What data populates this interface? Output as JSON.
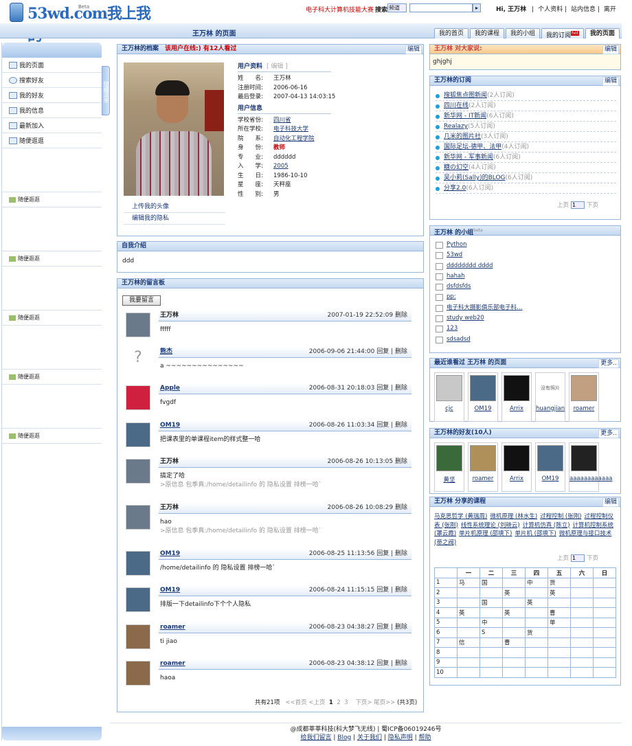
{
  "topbar": {
    "logo": "53wd.com我上我的",
    "logo_beta": "Beta",
    "contest_link": "电子科大计算机技能大赛",
    "search_label": "搜索",
    "search_scope": "频道",
    "search_value": "",
    "greeting": "Hi, 王万林",
    "links": [
      "个人资料",
      "站内信息",
      "离开"
    ]
  },
  "header": {
    "page_title": "王万林 的页面",
    "tabs": [
      "我的首页",
      "我的课程",
      "我的小组",
      "我的订阅",
      "我的页面"
    ],
    "tab_hot": "hot",
    "active_tab": "我的页面"
  },
  "sidebar": {
    "hide_menu": "隐藏菜单",
    "items": [
      "我的页面",
      "搜索好友",
      "我的好友",
      "我的信息",
      "最新加入",
      "随便逛逛"
    ],
    "repeat_items": [
      "随便逛逛",
      "随便逛逛",
      "随便逛逛",
      "随便逛逛",
      "随便逛逛"
    ]
  },
  "profile": {
    "title": "王万林的档案",
    "status": "该用户在线:) 有12人看过",
    "edit": "编辑",
    "photo_links": [
      "上传我的头像",
      "编辑我的隐私"
    ],
    "user_info_title": "用户资料",
    "user_info_edit": "[ 编辑 ]",
    "user_info": [
      {
        "k": "姓　　名:",
        "v": "王万林"
      },
      {
        "k": "注册时间:",
        "v": "2006-06-16"
      },
      {
        "k": "最后登录:",
        "v": "2007-04-13 14:03:15"
      }
    ],
    "user_detail_title": "用户信息",
    "user_detail_edit": "[ 编辑 ]",
    "user_detail": [
      {
        "k": "学校省份:",
        "v": "四川省"
      },
      {
        "k": "所在学校:",
        "v": "电子科技大学"
      },
      {
        "k": "院　　系:",
        "v": "自动化工程学院"
      },
      {
        "k": "身　　份:",
        "v": "教师"
      },
      {
        "k": "专　　业:",
        "v": "dddddd"
      },
      {
        "k": "入　　学:",
        "v": "2005"
      },
      {
        "k": "生　　日:",
        "v": "1986-10-10"
      },
      {
        "k": "星　　座:",
        "v": "天秤座"
      },
      {
        "k": "性　　别:",
        "v": "男"
      }
    ]
  },
  "intro": {
    "title": "自我介绍",
    "text": "ddd"
  },
  "board": {
    "title": "王万林的留言板",
    "leave_button": "我要留言",
    "messages": [
      {
        "name": "王万林",
        "time": "2007-01-19 22:52:09",
        "actions": "删除",
        "body": "fffff",
        "quote": ""
      },
      {
        "name": "熊杰",
        "time": "2006-09-06 21:44:00",
        "actions": "回复 | 删除",
        "body": "a ~~~~~~~~~~~~~~~",
        "quote": ""
      },
      {
        "name": "Apple",
        "time": "2006-08-31 20:18:03",
        "actions": "回复 | 删除",
        "body": "fvgdf",
        "quote": ""
      },
      {
        "name": "OM19",
        "time": "2006-08-26 11:03:34",
        "actions": "回复 | 删除",
        "body": "把课表里的单课程item的样式整一哈",
        "quote": ""
      },
      {
        "name": "王万林",
        "time": "2006-08-26 10:13:05",
        "actions": "删除",
        "body": "搞定了哈",
        "quote": ">原信息 包季真:/home/detailinfo 的 隐私设置 排榜一哈`"
      },
      {
        "name": "王万林",
        "time": "2006-08-26 10:08:29",
        "actions": "删除",
        "body": "hao",
        "quote": ">原信息 包季真:/home/detailinfo 的 隐私设置 排榜一哈`"
      },
      {
        "name": "OM19",
        "time": "2006-08-25 11:13:56",
        "actions": "回复 | 删除",
        "body": "/home/detailinfo 的 隐私设置 排榜一哈`",
        "quote": ""
      },
      {
        "name": "OM19",
        "time": "2006-08-24 11:15:15",
        "actions": "回复 | 删除",
        "body": "排版一下detailinfo下个个人隐私",
        "quote": ""
      },
      {
        "name": "roamer",
        "time": "2006-08-23 04:38:27",
        "actions": "回复 | 删除",
        "body": "ti jiao",
        "quote": ""
      },
      {
        "name": "roamer",
        "time": "2006-08-23 04:38:12",
        "actions": "回复 | 删除",
        "body": "haoa",
        "quote": ""
      }
    ],
    "pager": {
      "total": "共有21项",
      "first": "<<首页",
      "prev": "<上页",
      "pages": [
        "1",
        "2",
        "3"
      ],
      "next": "下页>",
      "last": "尾页>>",
      "count": "(共3页)"
    }
  },
  "shout": {
    "title": "王万林 对大家说:",
    "edit": "编辑",
    "text": "ghjghj"
  },
  "subscriptions": {
    "title": "王万林的订阅",
    "edit": "编辑",
    "items": [
      {
        "name": "搜狐焦点图新闻",
        "count": "(2人订阅)"
      },
      {
        "name": "四川在线",
        "count": "(2人订阅)"
      },
      {
        "name": "新华网 - IT新闻",
        "count": "(6人订阅)"
      },
      {
        "name": "Realazy",
        "count": "(5人订阅)"
      },
      {
        "name": "几米的图片社",
        "count": "(3人订阅)"
      },
      {
        "name": "国际足坛-德甲、法甲",
        "count": "(4人订阅)"
      },
      {
        "name": "新华网 - 军事新闻",
        "count": "(6人订阅)"
      },
      {
        "name": "糖の幻空",
        "count": "(4人订阅)"
      },
      {
        "name": "吴小莉(Sally)的BLOG",
        "count": "(6人订阅)"
      },
      {
        "name": "分享2.0",
        "count": "(6人订阅)"
      }
    ],
    "pager": {
      "prev": "上页",
      "page": "1",
      "next": "下页"
    }
  },
  "groups": {
    "title": "王万林 的小组",
    "beta": "beta",
    "items": [
      "Python",
      "53wd",
      "dddddddd dddd",
      "hahah",
      "dsfdsfds",
      "pp:",
      "电子科大摄影俱乐部电子科…",
      "study web20",
      "123",
      "sdsadsd"
    ]
  },
  "visitors": {
    "title": "最近谁看过 王万林 的页面",
    "more": "更多..",
    "items": [
      "cjc",
      "OM19",
      "Arrix",
      "huangjian",
      "roamer"
    ],
    "no_photo": "没有照片"
  },
  "friends": {
    "title": "王万林的好友(10人)",
    "more": "更多..",
    "items": [
      "黄坚",
      "roamer",
      "Arrix",
      "OM19",
      "aaaaaaaaaaaa"
    ]
  },
  "courses": {
    "title": "王万林 分享的课程",
    "edit": "编辑",
    "items": [
      "马克思哲学 (黄瑞周)",
      "微机原理 (林水生)",
      "过程控制 (张刚)",
      "过程控制仪表 (张刚)",
      "线性系统理论 (刘晓云)",
      "计算机仿真 (陈立)",
      "计算机控制系统 (罩云霞)",
      "单片机原理 (邵塽下)",
      "单片机 (邵塽下)",
      "微机原理与接口技术 (蒂之阀)"
    ],
    "pager": {
      "prev": "上页",
      "page": "1",
      "next": "下页"
    },
    "table_headers": [
      "",
      "一",
      "二",
      "三",
      "四",
      "五",
      "六",
      "日"
    ],
    "table_rows": [
      [
        "1",
        "马",
        "国",
        "",
        "中",
        "货",
        "",
        ""
      ],
      [
        "2",
        "",
        "",
        "英",
        "",
        "英",
        "",
        ""
      ],
      [
        "3",
        "",
        "国",
        "",
        "英",
        "",
        "",
        ""
      ],
      [
        "4",
        "英",
        "",
        "英",
        "",
        "曹",
        "",
        ""
      ],
      [
        "5",
        "",
        "中",
        "",
        "",
        "单",
        "",
        ""
      ],
      [
        "6",
        "",
        "S",
        "",
        "货",
        "",
        "",
        ""
      ],
      [
        "7",
        "信",
        "",
        "曹",
        "",
        "",
        "",
        ""
      ],
      [
        "8",
        "",
        "",
        "",
        "",
        "",
        "",
        ""
      ],
      [
        "9",
        "",
        "",
        "",
        "",
        "",
        "",
        ""
      ],
      [
        "10",
        "",
        "",
        "",
        "",
        "",
        "",
        ""
      ]
    ]
  },
  "footer": {
    "line1": "@成都莘莘科技(科大梦飞无线) | 蜀ICP备06019246号",
    "links": [
      "给我们留言",
      "Blog",
      "关于我们",
      "隐私声明",
      "帮助"
    ]
  }
}
